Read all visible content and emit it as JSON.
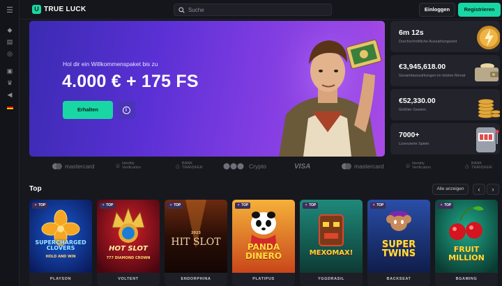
{
  "brand": {
    "name": "TRUE LUCK",
    "mark": "U",
    "accent": "#19d7a4"
  },
  "search": {
    "placeholder": "Suche"
  },
  "header": {
    "login": "Einloggen",
    "register": "Registrieren"
  },
  "rail": {
    "icons": [
      "menu-icon",
      "poker-chip-icon",
      "casino-icon",
      "live-icon",
      "gift-icon",
      "crown-icon",
      "megaphone-icon",
      "flag-de-icon"
    ]
  },
  "hero": {
    "subtitle": "Hol dir ein Willkommenspaket bis zu",
    "title": "4.000 € + 175 FS",
    "cta": "Erhalten",
    "info": "i"
  },
  "stats": [
    {
      "value": "6m 12s",
      "label": "Durchschnittliche Auszahlungszeit",
      "icon": "lightning-icon"
    },
    {
      "value": "€3,945,618.00",
      "label": "Gesamtauszahlungen im letzten Monat",
      "icon": "wallet-icon"
    },
    {
      "value": "€52,330.00",
      "label": "Größter Gewinn",
      "icon": "coins-icon"
    },
    {
      "value": "7000+",
      "label": "Lizenzierte Spiele",
      "icon": "slot-machine-icon"
    }
  ],
  "payments": [
    "mastercard",
    "Identity Verification",
    "BANK TRANSFER",
    "Crypto",
    "VISA",
    "mastercard",
    "Identity Verification",
    "BANK TRANSFER"
  ],
  "section": {
    "title": "Top",
    "view_all": "Alle anzeigen",
    "prev": "‹",
    "next": "›"
  },
  "games": [
    {
      "tag": "TOP",
      "name": "SUPERCHARGED CLOVERS",
      "sub": "HOLD AND WIN",
      "provider": "PLAYSON"
    },
    {
      "tag": "TOP",
      "name": "HOT SLOT",
      "sub": "777 DIAMOND CROWN",
      "provider": "VOLTENT"
    },
    {
      "tag": "TOP",
      "name": "HIT SLOT",
      "sub": "2023",
      "provider": "ENDORPHINA"
    },
    {
      "tag": "TOP",
      "name": "PANDA DINERO",
      "sub": "",
      "provider": "PLATIPUS"
    },
    {
      "tag": "TOP",
      "name": "MEXOMAX!",
      "sub": "",
      "provider": "YGGDRASIL"
    },
    {
      "tag": "TOP",
      "name": "SUPER TWINS",
      "sub": "",
      "provider": "BACKSEAT"
    },
    {
      "tag": "TOP",
      "name": "FRUIT MILLION",
      "sub": "",
      "provider": "BGAMING"
    }
  ]
}
